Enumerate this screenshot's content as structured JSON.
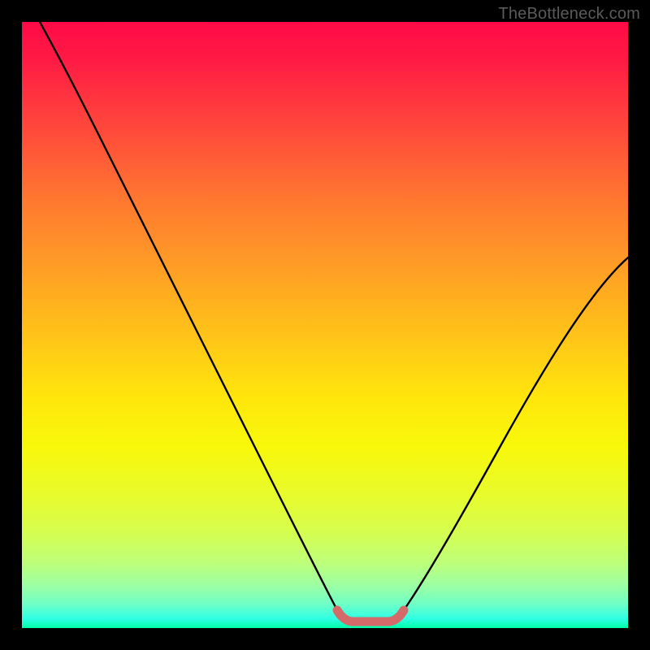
{
  "watermark": "TheBottleneck.com",
  "colors": {
    "frame_border": "#000000",
    "curve_stroke": "#000000",
    "bottom_segment": "#d46a6a",
    "gradient_top": "#ff0a47",
    "gradient_mid": "#ffe60c",
    "gradient_bottom": "#00ffa6"
  },
  "chart_data": {
    "type": "line",
    "title": "",
    "xlabel": "",
    "ylabel": "",
    "xlim": [
      0,
      100
    ],
    "ylim": [
      0,
      100
    ],
    "grid": false,
    "legend": false,
    "series": [
      {
        "name": "left-curve",
        "x": [
          3.0,
          10.0,
          20.0,
          30.0,
          40.0,
          48.0,
          52.0
        ],
        "values": [
          100.0,
          88.0,
          69.0,
          50.0,
          31.0,
          12.0,
          3.0
        ]
      },
      {
        "name": "right-curve",
        "x": [
          63.0,
          70.0,
          80.0,
          90.0,
          100.0
        ],
        "values": [
          3.0,
          12.0,
          28.0,
          45.0,
          61.0
        ]
      },
      {
        "name": "bottom-segment",
        "x": [
          52.0,
          53.0,
          54.0,
          56.0,
          58.0,
          60.0,
          61.0,
          62.0,
          63.0
        ],
        "values": [
          3.0,
          1.8,
          1.2,
          1.0,
          1.0,
          1.2,
          1.8,
          2.4,
          3.0
        ]
      }
    ],
    "annotations": [
      {
        "text": "TheBottleneck.com",
        "position": "top-right"
      }
    ]
  }
}
